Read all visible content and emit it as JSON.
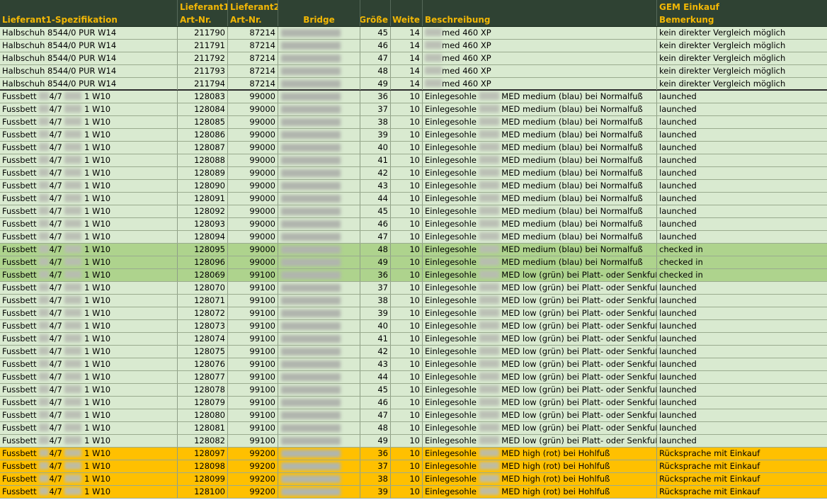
{
  "colors": {
    "header_bg": "#2f4233",
    "header_text": "#f2b705",
    "green_light": "#d9ead0",
    "green_medium": "#c4dfb0",
    "green_checked": "#aed38d",
    "orange": "#ffc000",
    "redacted": "#b8bcb3"
  },
  "headers": {
    "spec": [
      "",
      "Lieferant1-Spezifikation"
    ],
    "art1": [
      "Lieferant1-",
      "Art-Nr."
    ],
    "art2": [
      "Lieferant2-",
      "Art-Nr."
    ],
    "bridge": [
      "",
      "Bridge"
    ],
    "size": [
      "",
      "Größe"
    ],
    "width": [
      "",
      "Weite"
    ],
    "desc": [
      "",
      "Beschreibung"
    ],
    "remark": [
      "GEM Einkauf",
      "Bemerkung"
    ]
  },
  "rows": [
    {
      "spec_a": "Halbschuh 8544/0 PUR W14",
      "spec_b": "",
      "art1": "211790",
      "art2": "87214",
      "size": "45",
      "width": "14",
      "desc_a": "",
      "desc_b": "med 460 XP",
      "remark": "kein direkter Vergleich möglich",
      "color": "#d9ead0",
      "kind": "halb"
    },
    {
      "spec_a": "Halbschuh 8544/0 PUR W14",
      "spec_b": "",
      "art1": "211791",
      "art2": "87214",
      "size": "46",
      "width": "14",
      "desc_a": "",
      "desc_b": "med 460 XP",
      "remark": "kein direkter Vergleich möglich",
      "color": "#d9ead0",
      "kind": "halb"
    },
    {
      "spec_a": "Halbschuh 8544/0 PUR W14",
      "spec_b": "",
      "art1": "211792",
      "art2": "87214",
      "size": "47",
      "width": "14",
      "desc_a": "",
      "desc_b": "med 460 XP",
      "remark": "kein direkter Vergleich möglich",
      "color": "#d9ead0",
      "kind": "halb"
    },
    {
      "spec_a": "Halbschuh 8544/0 PUR W14",
      "spec_b": "",
      "art1": "211793",
      "art2": "87214",
      "size": "48",
      "width": "14",
      "desc_a": "",
      "desc_b": "med 460 XP",
      "remark": "kein direkter Vergleich möglich",
      "color": "#d9ead0",
      "kind": "halb"
    },
    {
      "spec_a": "Halbschuh 8544/0 PUR W14",
      "spec_b": "",
      "art1": "211794",
      "art2": "87214",
      "size": "49",
      "width": "14",
      "desc_a": "",
      "desc_b": "med 460 XP",
      "remark": "kein direkter Vergleich möglich",
      "color": "#d9ead0",
      "kind": "halb",
      "sep": true
    },
    {
      "spec_a": "Fussbett",
      "spec_b": "4/7",
      "spec_c": "1 W10",
      "art1": "128083",
      "art2": "99000",
      "size": "36",
      "width": "10",
      "desc_a": "Einlegesohle",
      "desc_b": "MED medium (blau) bei Normalfuß",
      "remark": "launched",
      "color": "#d9ead0",
      "kind": "fuss"
    },
    {
      "spec_a": "Fussbett",
      "spec_b": "4/7",
      "spec_c": "1 W10",
      "art1": "128084",
      "art2": "99000",
      "size": "37",
      "width": "10",
      "desc_a": "Einlegesohle",
      "desc_b": "MED medium (blau) bei Normalfuß",
      "remark": "launched",
      "color": "#d9ead0",
      "kind": "fuss"
    },
    {
      "spec_a": "Fussbett",
      "spec_b": "4/7",
      "spec_c": "1 W10",
      "art1": "128085",
      "art2": "99000",
      "size": "38",
      "width": "10",
      "desc_a": "Einlegesohle",
      "desc_b": "MED medium (blau) bei Normalfuß",
      "remark": "launched",
      "color": "#d9ead0",
      "kind": "fuss"
    },
    {
      "spec_a": "Fussbett",
      "spec_b": "4/7",
      "spec_c": "1 W10",
      "art1": "128086",
      "art2": "99000",
      "size": "39",
      "width": "10",
      "desc_a": "Einlegesohle",
      "desc_b": "MED medium (blau) bei Normalfuß",
      "remark": "launched",
      "color": "#d9ead0",
      "kind": "fuss"
    },
    {
      "spec_a": "Fussbett",
      "spec_b": "4/7",
      "spec_c": "1 W10",
      "art1": "128087",
      "art2": "99000",
      "size": "40",
      "width": "10",
      "desc_a": "Einlegesohle",
      "desc_b": "MED medium (blau) bei Normalfuß",
      "remark": "launched",
      "color": "#d9ead0",
      "kind": "fuss"
    },
    {
      "spec_a": "Fussbett",
      "spec_b": "4/7",
      "spec_c": "1 W10",
      "art1": "128088",
      "art2": "99000",
      "size": "41",
      "width": "10",
      "desc_a": "Einlegesohle",
      "desc_b": "MED medium (blau) bei Normalfuß",
      "remark": "launched",
      "color": "#d9ead0",
      "kind": "fuss"
    },
    {
      "spec_a": "Fussbett",
      "spec_b": "4/7",
      "spec_c": "1 W10",
      "art1": "128089",
      "art2": "99000",
      "size": "42",
      "width": "10",
      "desc_a": "Einlegesohle",
      "desc_b": "MED medium (blau) bei Normalfuß",
      "remark": "launched",
      "color": "#d9ead0",
      "kind": "fuss"
    },
    {
      "spec_a": "Fussbett",
      "spec_b": "4/7",
      "spec_c": "1 W10",
      "art1": "128090",
      "art2": "99000",
      "size": "43",
      "width": "10",
      "desc_a": "Einlegesohle",
      "desc_b": "MED medium (blau) bei Normalfuß",
      "remark": "launched",
      "color": "#d9ead0",
      "kind": "fuss"
    },
    {
      "spec_a": "Fussbett",
      "spec_b": "4/7",
      "spec_c": "1 W10",
      "art1": "128091",
      "art2": "99000",
      "size": "44",
      "width": "10",
      "desc_a": "Einlegesohle",
      "desc_b": "MED medium (blau) bei Normalfuß",
      "remark": "launched",
      "color": "#d9ead0",
      "kind": "fuss"
    },
    {
      "spec_a": "Fussbett",
      "spec_b": "4/7",
      "spec_c": "1 W10",
      "art1": "128092",
      "art2": "99000",
      "size": "45",
      "width": "10",
      "desc_a": "Einlegesohle",
      "desc_b": "MED medium (blau) bei Normalfuß",
      "remark": "launched",
      "color": "#d9ead0",
      "kind": "fuss"
    },
    {
      "spec_a": "Fussbett",
      "spec_b": "4/7",
      "spec_c": "1 W10",
      "art1": "128093",
      "art2": "99000",
      "size": "46",
      "width": "10",
      "desc_a": "Einlegesohle",
      "desc_b": "MED medium (blau) bei Normalfuß",
      "remark": "launched",
      "color": "#d9ead0",
      "kind": "fuss"
    },
    {
      "spec_a": "Fussbett",
      "spec_b": "4/7",
      "spec_c": "1 W10",
      "art1": "128094",
      "art2": "99000",
      "size": "47",
      "width": "10",
      "desc_a": "Einlegesohle",
      "desc_b": "MED medium (blau) bei Normalfuß",
      "remark": "launched",
      "color": "#d9ead0",
      "kind": "fuss"
    },
    {
      "spec_a": "Fussbett",
      "spec_b": "4/7",
      "spec_c": "1 W10",
      "art1": "128095",
      "art2": "99000",
      "size": "48",
      "width": "10",
      "desc_a": "Einlegesohle",
      "desc_b": "MED medium (blau) bei Normalfuß",
      "remark": "checked in",
      "color": "#aed38d",
      "kind": "fuss"
    },
    {
      "spec_a": "Fussbett",
      "spec_b": "4/7",
      "spec_c": "1 W10",
      "art1": "128096",
      "art2": "99000",
      "size": "49",
      "width": "10",
      "desc_a": "Einlegesohle",
      "desc_b": "MED medium (blau) bei Normalfuß",
      "remark": "checked in",
      "color": "#aed38d",
      "kind": "fuss"
    },
    {
      "spec_a": "Fussbett",
      "spec_b": "4/7",
      "spec_c": "1 W10",
      "art1": "128069",
      "art2": "99100",
      "size": "36",
      "width": "10",
      "desc_a": "Einlegesohle",
      "desc_b": "MED low (grün) bei Platt- oder Senkfuß",
      "remark": "checked in",
      "color": "#aed38d",
      "kind": "fuss"
    },
    {
      "spec_a": "Fussbett",
      "spec_b": "4/7",
      "spec_c": "1 W10",
      "art1": "128070",
      "art2": "99100",
      "size": "37",
      "width": "10",
      "desc_a": "Einlegesohle",
      "desc_b": "MED low (grün) bei Platt- oder Senkfuß",
      "remark": "launched",
      "color": "#d9ead0",
      "kind": "fuss"
    },
    {
      "spec_a": "Fussbett",
      "spec_b": "4/7",
      "spec_c": "1 W10",
      "art1": "128071",
      "art2": "99100",
      "size": "38",
      "width": "10",
      "desc_a": "Einlegesohle",
      "desc_b": "MED low (grün) bei Platt- oder Senkfuß",
      "remark": "launched",
      "color": "#d9ead0",
      "kind": "fuss"
    },
    {
      "spec_a": "Fussbett",
      "spec_b": "4/7",
      "spec_c": "1 W10",
      "art1": "128072",
      "art2": "99100",
      "size": "39",
      "width": "10",
      "desc_a": "Einlegesohle",
      "desc_b": "MED low (grün) bei Platt- oder Senkfuß",
      "remark": "launched",
      "color": "#d9ead0",
      "kind": "fuss"
    },
    {
      "spec_a": "Fussbett",
      "spec_b": "4/7",
      "spec_c": "1 W10",
      "art1": "128073",
      "art2": "99100",
      "size": "40",
      "width": "10",
      "desc_a": "Einlegesohle",
      "desc_b": "MED low (grün) bei Platt- oder Senkfuß",
      "remark": "launched",
      "color": "#d9ead0",
      "kind": "fuss"
    },
    {
      "spec_a": "Fussbett",
      "spec_b": "4/7",
      "spec_c": "1 W10",
      "art1": "128074",
      "art2": "99100",
      "size": "41",
      "width": "10",
      "desc_a": "Einlegesohle",
      "desc_b": "MED low (grün) bei Platt- oder Senkfuß",
      "remark": "launched",
      "color": "#d9ead0",
      "kind": "fuss"
    },
    {
      "spec_a": "Fussbett",
      "spec_b": "4/7",
      "spec_c": "1 W10",
      "art1": "128075",
      "art2": "99100",
      "size": "42",
      "width": "10",
      "desc_a": "Einlegesohle",
      "desc_b": "MED low (grün) bei Platt- oder Senkfuß",
      "remark": "launched",
      "color": "#d9ead0",
      "kind": "fuss"
    },
    {
      "spec_a": "Fussbett",
      "spec_b": "4/7",
      "spec_c": "1 W10",
      "art1": "128076",
      "art2": "99100",
      "size": "43",
      "width": "10",
      "desc_a": "Einlegesohle",
      "desc_b": "MED low (grün) bei Platt- oder Senkfuß",
      "remark": "launched",
      "color": "#d9ead0",
      "kind": "fuss"
    },
    {
      "spec_a": "Fussbett",
      "spec_b": "4/7",
      "spec_c": "1 W10",
      "art1": "128077",
      "art2": "99100",
      "size": "44",
      "width": "10",
      "desc_a": "Einlegesohle",
      "desc_b": "MED low (grün) bei Platt- oder Senkfuß",
      "remark": "launched",
      "color": "#d9ead0",
      "kind": "fuss"
    },
    {
      "spec_a": "Fussbett",
      "spec_b": "4/7",
      "spec_c": "1 W10",
      "art1": "128078",
      "art2": "99100",
      "size": "45",
      "width": "10",
      "desc_a": "Einlegesohle",
      "desc_b": "MED low (grün) bei Platt- oder Senkfuß",
      "remark": "launched",
      "color": "#d9ead0",
      "kind": "fuss"
    },
    {
      "spec_a": "Fussbett",
      "spec_b": "4/7",
      "spec_c": "1 W10",
      "art1": "128079",
      "art2": "99100",
      "size": "46",
      "width": "10",
      "desc_a": "Einlegesohle",
      "desc_b": "MED low (grün) bei Platt- oder Senkfuß",
      "remark": "launched",
      "color": "#d9ead0",
      "kind": "fuss"
    },
    {
      "spec_a": "Fussbett",
      "spec_b": "4/7",
      "spec_c": "1 W10",
      "art1": "128080",
      "art2": "99100",
      "size": "47",
      "width": "10",
      "desc_a": "Einlegesohle",
      "desc_b": "MED low (grün) bei Platt- oder Senkfuß",
      "remark": "launched",
      "color": "#d9ead0",
      "kind": "fuss"
    },
    {
      "spec_a": "Fussbett",
      "spec_b": "4/7",
      "spec_c": "1 W10",
      "art1": "128081",
      "art2": "99100",
      "size": "48",
      "width": "10",
      "desc_a": "Einlegesohle",
      "desc_b": "MED low (grün) bei Platt- oder Senkfuß",
      "remark": "launched",
      "color": "#d9ead0",
      "kind": "fuss"
    },
    {
      "spec_a": "Fussbett",
      "spec_b": "4/7",
      "spec_c": "1 W10",
      "art1": "128082",
      "art2": "99100",
      "size": "49",
      "width": "10",
      "desc_a": "Einlegesohle",
      "desc_b": "MED low (grün) bei Platt- oder Senkfuß",
      "remark": "launched",
      "color": "#d9ead0",
      "kind": "fuss"
    },
    {
      "spec_a": "Fussbett",
      "spec_b": "4/7",
      "spec_c": "1 W10",
      "art1": "128097",
      "art2": "99200",
      "size": "36",
      "width": "10",
      "desc_a": "Einlegesohle",
      "desc_b": "MED high (rot) bei Hohlfuß",
      "remark": "Rücksprache mit Einkauf",
      "color": "#ffc000",
      "kind": "fuss"
    },
    {
      "spec_a": "Fussbett",
      "spec_b": "4/7",
      "spec_c": "1 W10",
      "art1": "128098",
      "art2": "99200",
      "size": "37",
      "width": "10",
      "desc_a": "Einlegesohle",
      "desc_b": "MED high (rot) bei Hohlfuß",
      "remark": "Rücksprache mit Einkauf",
      "color": "#ffc000",
      "kind": "fuss"
    },
    {
      "spec_a": "Fussbett",
      "spec_b": "4/7",
      "spec_c": "1 W10",
      "art1": "128099",
      "art2": "99200",
      "size": "38",
      "width": "10",
      "desc_a": "Einlegesohle",
      "desc_b": "MED high (rot) bei Hohlfuß",
      "remark": "Rücksprache mit Einkauf",
      "color": "#ffc000",
      "kind": "fuss"
    },
    {
      "spec_a": "Fussbett",
      "spec_b": "4/7",
      "spec_c": "1 W10",
      "art1": "128100",
      "art2": "99200",
      "size": "39",
      "width": "10",
      "desc_a": "Einlegesohle",
      "desc_b": "MED high (rot) bei Hohlfuß",
      "remark": "Rücksprache mit Einkauf",
      "color": "#ffc000",
      "kind": "fuss"
    }
  ]
}
